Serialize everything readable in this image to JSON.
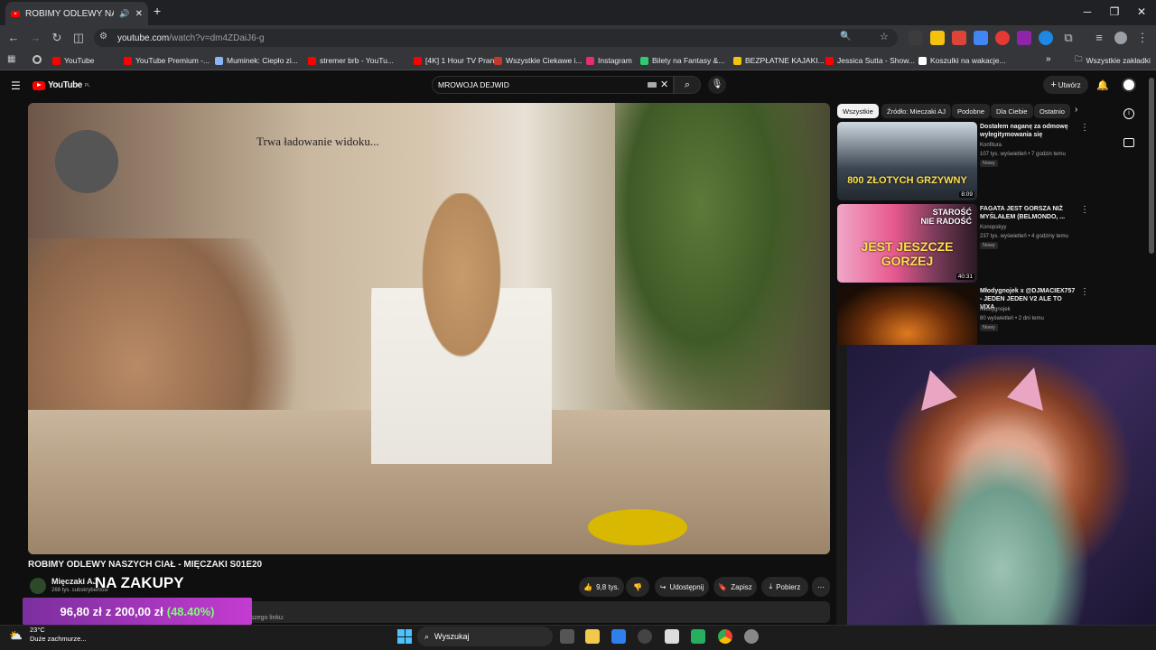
{
  "browser": {
    "tab_title": "ROBIMY ODLEWY NASZYCH CIAŁ - MIĘCZAKI",
    "url_host": "youtube.com",
    "url_path": "/watch?v=dm4ZDaiJ6-g",
    "new_tab": "+",
    "bookmarks": [
      {
        "label": "YouTube",
        "color": "#ff0000"
      },
      {
        "label": "YouTube Premium -...",
        "color": "#ff0000"
      },
      {
        "label": "Muminek: Ciepło zi...",
        "color": "#8ab4f8"
      },
      {
        "label": "stremer brb - YouTu...",
        "color": "#ff0000"
      },
      {
        "label": "[4K] 1 Hour TV Pran...",
        "color": "#ff0000"
      },
      {
        "label": "Wszystkie Ciekawe i...",
        "color": "#c0392b"
      },
      {
        "label": "Instagram",
        "color": "#e1306c"
      },
      {
        "label": "Bilety na Fantasy &...",
        "color": "#2ecc71"
      },
      {
        "label": "BEZPŁATNE KAJAKI...",
        "color": "#f1c40f"
      },
      {
        "label": "Jessica Sutta - Show...",
        "color": "#ff0000"
      },
      {
        "label": "Koszulki na wakacje...",
        "color": "#ffffff"
      }
    ],
    "all_bookmarks": "Wszystkie zakładki"
  },
  "youtube": {
    "logo": "YouTube",
    "logo_region": "PL",
    "search_value": "MROWOJA DEJWID",
    "create_label": "Utwórz",
    "loading_text": "Trwa ładowanie widoku...",
    "video_title": "ROBIMY ODLEWY NASZYCH CIAŁ - MIĘCZAKI S01E20",
    "channel_name": "Mięczaki AJ",
    "channel_subs": "268 tys. subskrybentów",
    "overlay_text": "NA ZAKUPY",
    "like_count": "9,8 tys.",
    "share_label": "Udostępnij",
    "save_label": "Zapisz",
    "download_label": "Pobierz",
    "description_snippet": "naszego linku:"
  },
  "chips": [
    "Wszystkie",
    "Źródło: Mieczaki AJ",
    "Podobne",
    "Dla Ciebie",
    "Ostatnio"
  ],
  "recommendations": [
    {
      "title": "Dostałem naganę za odmowę wylegitymowania się",
      "channel": "Konfitura",
      "meta": "107 tys. wyświetleń • 7 godzin temu",
      "badge": "Nowy",
      "duration": "8:09",
      "thumb_text": "800 ZŁOTYCH GRZYWNY"
    },
    {
      "title": "FAGATA JEST GORSZA NIŻ MYŚLAŁEM (BELMONDO, ...",
      "channel": "Konopskyy",
      "meta": "237 tys. wyświetleń • 4 godziny temu",
      "badge": "Nowy",
      "duration": "40:31",
      "thumb_text": "JEST JESZCZE GORZEJ",
      "thumb_text2": "STAROŚĆ NIE RADOŚĆ"
    },
    {
      "title": "Młodygnojek x @DJMACIEX757 - JEDEN JEDEN V2 ALE TO VIXA",
      "channel": "Młodygnojek",
      "meta": "80 wyświetleń • 2 dni temu",
      "badge": "Nowy",
      "duration": "",
      "thumb_text": ""
    }
  ],
  "donation": {
    "current": "96,80 zł",
    "sep": "z",
    "goal": "200,00 zł",
    "percent": "(48.40%)"
  },
  "taskbar": {
    "temp": "23°C",
    "weather": "Duże zachmurze...",
    "search_placeholder": "Wyszukaj"
  }
}
